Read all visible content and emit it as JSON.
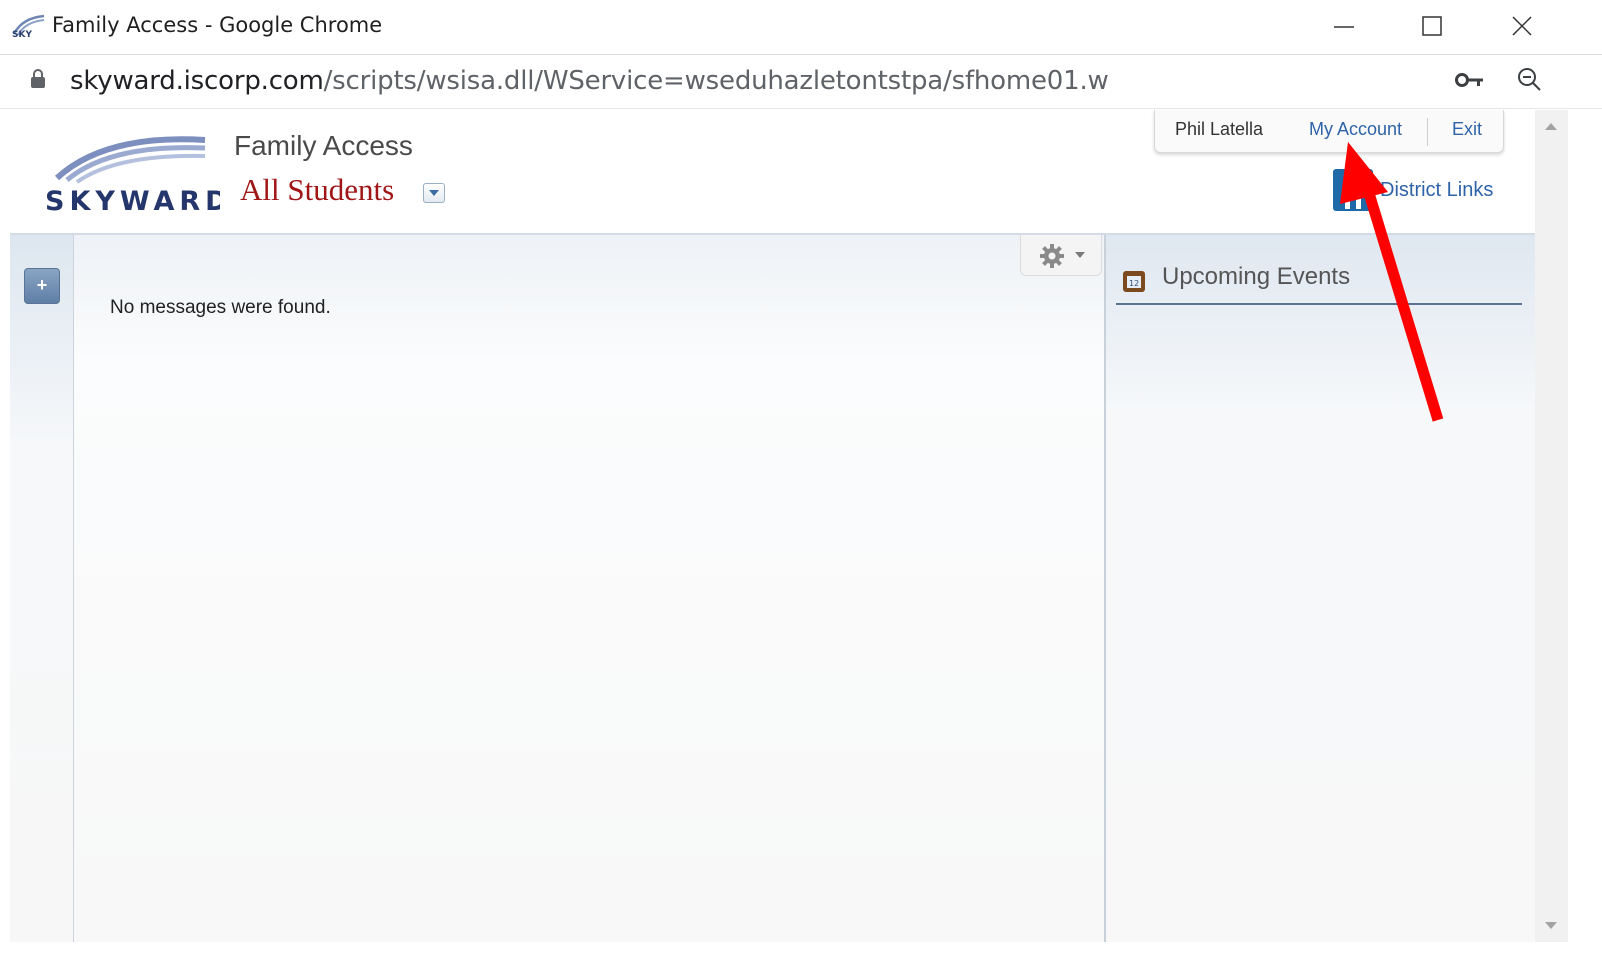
{
  "window": {
    "title": "Family Access - Google Chrome"
  },
  "addressbar": {
    "url_host": "skyward.iscorp.com",
    "url_path": "/scripts/wsisa.dll/WService=wseduhazletontstpa/sfhome01.w"
  },
  "header": {
    "app_name": "Family Access",
    "student_selector": "All Students",
    "user_name": "Phil Latella",
    "my_account": "My Account",
    "exit": "Exit",
    "district_links": "District Links"
  },
  "main": {
    "messages_empty": "No messages were found."
  },
  "sidebar_right": {
    "title": "Upcoming Events"
  },
  "colors": {
    "brand_blue": "#2e63a8",
    "student_red": "#a01515",
    "annotation_arrow": "#ff0000"
  },
  "icons": [
    "skyward-logo",
    "lock-icon",
    "key-icon",
    "zoom-icon",
    "dropdown-icon",
    "plus-icon",
    "gear-icon",
    "calendar-icon",
    "district-links-icon"
  ]
}
